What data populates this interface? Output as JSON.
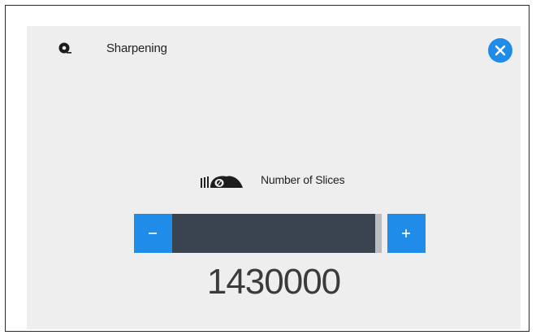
{
  "header": {
    "title": "Sharpening",
    "icon": "sharpening-icon",
    "close_icon": "close-icon"
  },
  "setting": {
    "label": "Number of Slices",
    "icon": "slices-icon",
    "value": "1430000",
    "decrement_icon": "minus-icon",
    "increment_icon": "plus-icon",
    "level": 0.97
  },
  "colors": {
    "accent": "#1e8ce8",
    "track": "#3a4450",
    "panel": "#eeeeef"
  }
}
